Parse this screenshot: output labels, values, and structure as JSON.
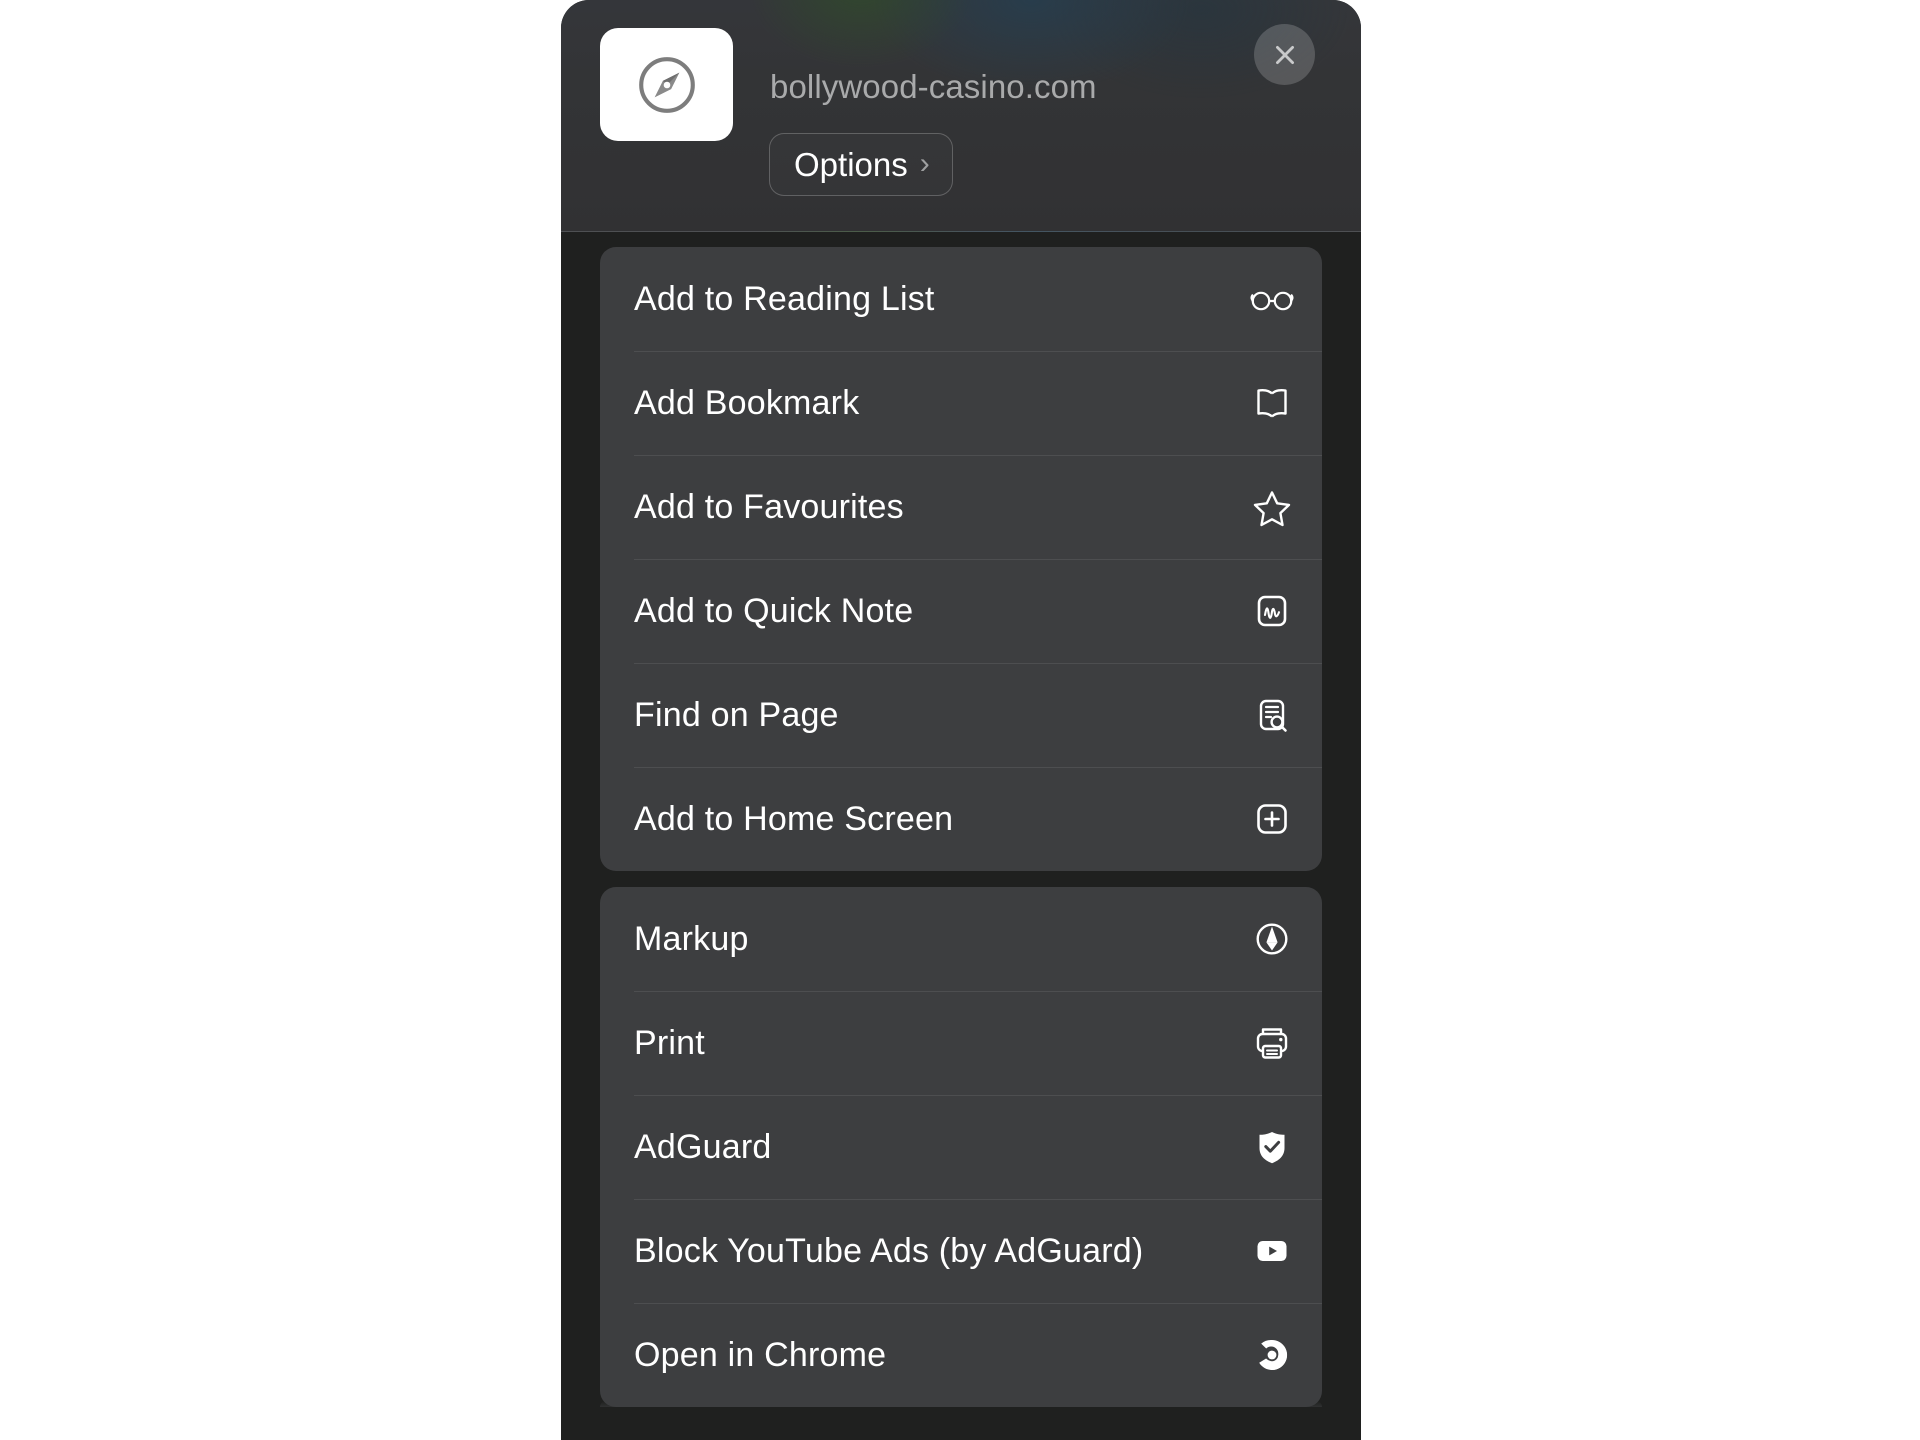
{
  "sheet": {
    "header": {
      "app_icon_name": "safari-compass-icon",
      "site_url": "bollywood-casino.com",
      "options_label": "Options",
      "options_chevron": "›",
      "close_label": "Close"
    },
    "groups": [
      {
        "id": "safari-actions",
        "items": [
          {
            "label": "Add to Reading List",
            "icon": "glasses-icon"
          },
          {
            "label": "Add Bookmark",
            "icon": "open-book-icon"
          },
          {
            "label": "Add to Favourites",
            "icon": "star-outline-icon"
          },
          {
            "label": "Add to Quick Note",
            "icon": "quick-note-icon"
          },
          {
            "label": "Find on Page",
            "icon": "find-on-page-icon"
          },
          {
            "label": "Add to Home Screen",
            "icon": "add-to-home-screen-icon"
          }
        ]
      },
      {
        "id": "extensions",
        "items": [
          {
            "label": "Markup",
            "icon": "markup-pen-icon"
          },
          {
            "label": "Print",
            "icon": "printer-icon"
          },
          {
            "label": "AdGuard",
            "icon": "adguard-shield-icon"
          },
          {
            "label": "Block YouTube Ads (by AdGuard)",
            "icon": "youtube-icon"
          },
          {
            "label": "Open in Chrome",
            "icon": "chrome-icon"
          }
        ]
      }
    ]
  },
  "colors": {
    "page_background": "#ffffff",
    "sheet_background": "#1f201f",
    "card_background": "#3d3e40",
    "header_background": "#333436",
    "primary_text": "#ffffff",
    "secondary_text": "#a9aaab",
    "separator": "rgba(255,255,255,0.085)"
  }
}
